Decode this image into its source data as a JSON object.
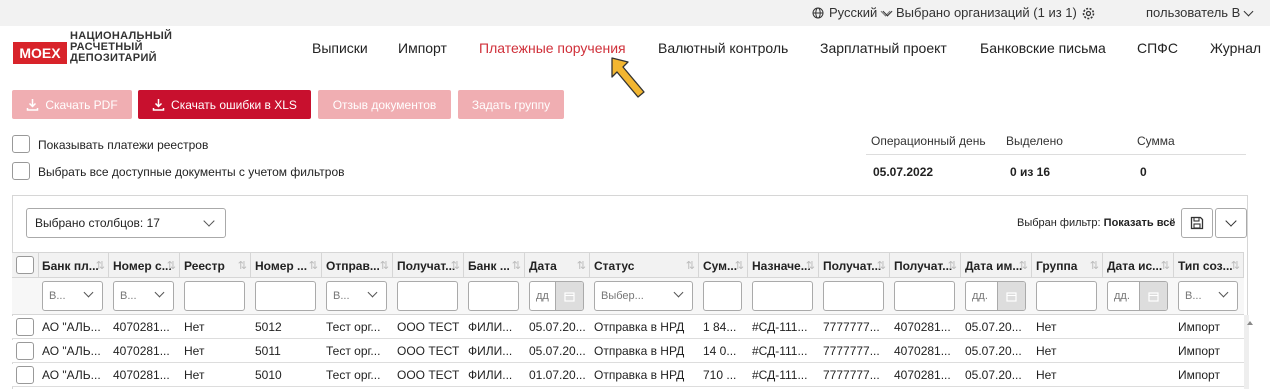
{
  "topbar": {
    "language": "Русский",
    "orgs": "Выбрано организаций (1 из 1)",
    "user": "пользователь В"
  },
  "logo": {
    "badge": "MOEX",
    "line1": "НАЦИОНАЛЬНЫЙ",
    "line2": "РАСЧЕТНЫЙ",
    "line3": "ДЕПОЗИТАРИЙ"
  },
  "nav": [
    "Выписки",
    "Импорт",
    "Платежные поручения",
    "Валютный контроль",
    "Зарплатный проект",
    "Банковские письма",
    "СПФС",
    "Журнал"
  ],
  "actions": {
    "pdf": "Скачать PDF",
    "xls": "Скачать ошибки в XLS",
    "recall": "Отзыв документов",
    "group": "Задать группу"
  },
  "options": {
    "show_registry": "Показывать платежи реестров",
    "select_all": "Выбрать все доступные документы с учетом фильтров"
  },
  "summary": {
    "op_day_label": "Операционный день",
    "selected_label": "Выделено",
    "sum_label": "Сумма",
    "op_day": "05.07.2022",
    "selected": "0 из 16",
    "sum": "0"
  },
  "table_tools": {
    "columns": "Выбрано столбцов: 17",
    "filter_prefix": "Выбран фильтр:",
    "filter_value": "Показать всё"
  },
  "columns": [
    "Банк пл...",
    "Номер с...",
    "Реестр",
    "Номер ...",
    "Отправ...",
    "Получат...",
    "Банк ...",
    "Дата",
    "Статус",
    "Сум...",
    "Назначе...",
    "Получат...",
    "Получат...",
    "Дата им...",
    "Группа",
    "Дата ис...",
    "Тип соз..."
  ],
  "filters": {
    "select_short": "В...",
    "status_placeholder": "Выбер...",
    "date_placeholder": "дд",
    "date_placeholder2": "дд."
  },
  "rows": [
    [
      "АО \"АЛЬ...",
      "4070281...",
      "Нет",
      "5012",
      "Тест орг...",
      "ООО ТЕСТ",
      "ФИЛИ...",
      "05.07.20...",
      "Отправка в НРД",
      "1 84...",
      "#СД-111...",
      "7777777...",
      "4070281...",
      "05.07.20...",
      "Нет",
      "",
      "Импорт"
    ],
    [
      "АО \"АЛЬ...",
      "4070281...",
      "Нет",
      "5011",
      "Тест орг...",
      "ООО ТЕСТ",
      "ФИЛИ...",
      "05.07.20...",
      "Отправка в НРД",
      "14 0...",
      "#СД-111...",
      "7777777...",
      "4070281...",
      "05.07.20...",
      "Нет",
      "",
      "Импорт"
    ],
    [
      "АО \"АЛЬ...",
      "4070281...",
      "Нет",
      "5010",
      "Тест орг...",
      "ООО ТЕСТ",
      "ФИЛИ...",
      "01.07.20...",
      "Отправка в НРД",
      "710 ...",
      "#СД-111...",
      "7777777...",
      "4070281...",
      "05.07.20...",
      "Нет",
      "",
      "Импорт"
    ]
  ]
}
